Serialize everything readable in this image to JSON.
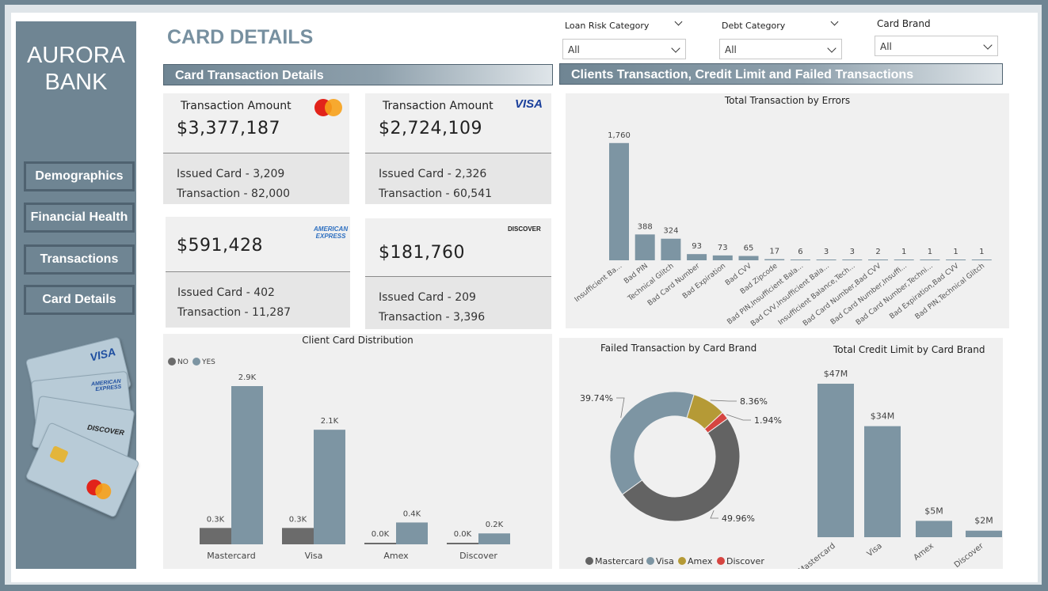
{
  "app": {
    "brand_line1": "AURORA",
    "brand_line2": "BANK",
    "page_title": "CARD DETAILS"
  },
  "nav": [
    "Demographics",
    "Financial Health",
    "Transactions",
    "Card Details"
  ],
  "sidebar_cards": [
    "VISA",
    "AMERICAN EXPRESS",
    "DISCOVER"
  ],
  "filters": [
    {
      "label": "Loan Risk Category",
      "value": "All"
    },
    {
      "label": "Debt Category",
      "value": "All"
    },
    {
      "label": "Card Brand",
      "value": "All"
    }
  ],
  "sections": {
    "left": "Card Transaction Details",
    "right": "Clients Transaction, Credit Limit and Failed Transactions"
  },
  "kpis": {
    "mastercard": {
      "amount_label": "Transaction Amount",
      "amount": "$3,377,187",
      "issued": "Issued Card - 3,209",
      "transactions": "Transaction - 82,000"
    },
    "visa": {
      "amount_label": "Transaction Amount",
      "amount": "$2,724,109",
      "issued": "Issued Card - 2,326",
      "transactions": "Transaction - 60,541",
      "logo": "VISA"
    },
    "amex": {
      "amount": "$591,428",
      "issued": "Issued Card - 402",
      "transactions": "Transaction - 11,287",
      "logo_line1": "AMERICAN",
      "logo_line2": "EXPRESS"
    },
    "discover": {
      "amount": "$181,760",
      "issued": "Issued Card - 209",
      "transactions": "Transaction - 3,396",
      "logo": "DISCOVER"
    }
  },
  "colors": {
    "slate": "#7d95a3",
    "dark": "#6b6b6b",
    "gold": "#b59a36",
    "red": "#d64541",
    "sidebar": "#6f8593"
  },
  "chart_data": [
    {
      "id": "errors",
      "type": "bar",
      "title": "Total Transaction by Errors",
      "categories": [
        "Insufficient Ba...",
        "Bad PIN",
        "Technical Glitch",
        "Bad Card Number",
        "Bad Expiration",
        "Bad CVV",
        "Bad Zipcode",
        "Bad PIN,Insufficient Bala...",
        "Bad CVV,Insufficient Bala...",
        "Insufficient Balance,Tech...",
        "Bad Card Number,Bad CVV",
        "Bad Card Number,Insuffi...",
        "Bad Card Number,Techni...",
        "Bad Expiration,Bad CVV",
        "Bad PIN,Technical Glitch"
      ],
      "values": [
        1760,
        388,
        324,
        93,
        73,
        65,
        17,
        6,
        3,
        3,
        2,
        1,
        1,
        1,
        1
      ],
      "data_labels": [
        "1,760",
        "388",
        "324",
        "93",
        "73",
        "65",
        "17",
        "6",
        "3",
        "3",
        "2",
        "1",
        "1",
        "1",
        "1"
      ],
      "ylim": [
        0,
        1900
      ],
      "grid": false
    },
    {
      "id": "distribution",
      "type": "bar",
      "title": "Client Card Distribution",
      "categories": [
        "Mastercard",
        "Visa",
        "Amex",
        "Discover"
      ],
      "series": [
        {
          "name": "NO",
          "values": [
            0.3,
            0.3,
            0.0,
            0.0
          ],
          "labels": [
            "0.3K",
            "0.3K",
            "0.0K",
            "0.0K"
          ],
          "color": "#6b6b6b"
        },
        {
          "name": "YES",
          "values": [
            2.9,
            2.1,
            0.4,
            0.2
          ],
          "labels": [
            "2.9K",
            "2.1K",
            "0.4K",
            "0.2K"
          ],
          "color": "#7d95a3"
        }
      ],
      "ylim": [
        0,
        3.0
      ],
      "legend": "top-left"
    },
    {
      "id": "failed",
      "type": "pie",
      "title": "Failed Transaction by Card Brand",
      "categories": [
        "Mastercard",
        "Visa",
        "Amex",
        "Discover"
      ],
      "values": [
        49.96,
        39.74,
        8.36,
        1.94
      ],
      "labels": [
        "49.96%",
        "39.74%",
        "8.36%",
        "1.94%"
      ],
      "colors": [
        "#636363",
        "#7d95a3",
        "#b59a36",
        "#d64541"
      ],
      "legend": "bottom"
    },
    {
      "id": "credit",
      "type": "bar",
      "title": "Total Credit Limit by Card Brand",
      "categories": [
        "Mastercard",
        "Visa",
        "Amex",
        "Discover"
      ],
      "values": [
        47,
        34,
        5,
        2
      ],
      "labels": [
        "$47M",
        "$34M",
        "$5M",
        "$2M"
      ],
      "ylim": [
        0,
        50
      ]
    }
  ]
}
